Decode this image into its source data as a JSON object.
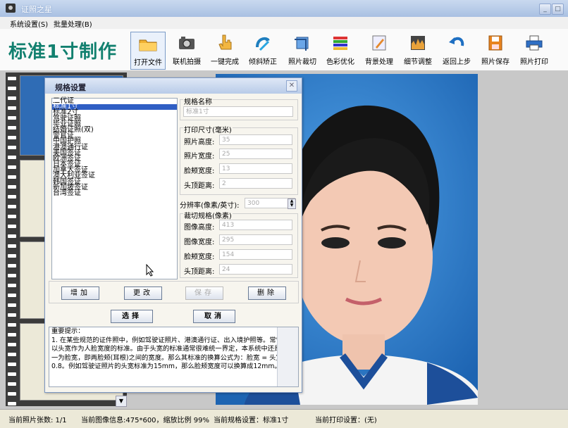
{
  "window": {
    "title": "证照之星"
  },
  "menu": {
    "items": [
      "系统设置(S)",
      "批量处理(B)"
    ]
  },
  "toolbar": {
    "app_heading": "标准1寸制作",
    "buttons": [
      "打开文件",
      "联机拍摄",
      "一键完成",
      "倾斜矫正",
      "照片裁切",
      "色彩优化",
      "背景处理",
      "细节调整",
      "返回上步",
      "照片保存",
      "照片打印"
    ]
  },
  "dialog": {
    "title": "规格设置",
    "spec_list": [
      "二代证",
      "标准1寸",
      "标准2寸",
      "驾驶证照",
      "毕业证照",
      "结婚证照(双)",
      "警官证",
      "中国护照",
      "港澳通行证",
      "美国签证",
      "欧洲签证",
      "日本签证",
      "加拿大签证",
      "澳大利亚签证",
      "韩国签证",
      "新加坡签证",
      "台湾签证"
    ],
    "selected_index": 1,
    "spec_name_group": "规格名称",
    "spec_name_value": "标准1寸",
    "print_size_group": "打印尺寸(毫米)",
    "print_size_fields": [
      {
        "label": "照片高度:",
        "value": "35"
      },
      {
        "label": "照片宽度:",
        "value": "25"
      },
      {
        "label": "脸颊宽度:",
        "value": "13"
      },
      {
        "label": "头顶距离:",
        "value": "2"
      }
    ],
    "resolution_label": "分辨率(像素/英寸):",
    "resolution_value": "300",
    "crop_group": "裁切规格(像素)",
    "crop_fields": [
      {
        "label": "图像高度:",
        "value": "413"
      },
      {
        "label": "图像宽度:",
        "value": "295"
      },
      {
        "label": "脸颊宽度:",
        "value": "154"
      },
      {
        "label": "头顶距离:",
        "value": "24"
      }
    ],
    "buttons": {
      "add": "增加",
      "modify": "更改",
      "save": "保存",
      "delete": "删除",
      "select": "选择",
      "cancel": "取消"
    },
    "notes": "重要提示：\n1. 在某些规范的证件照中，例如驾驶证照片、港澳通行证、出入境护照等。常常以头宽作为人脸宽度的标准。由于头宽的标准通常很难统一界定，本系统中还是统一为脸宽，即两脸颊(耳根)之间的宽度。那么其标准的换算公式为：脸宽 = 头宽 * 0.8。例如驾驶证照片的头宽标准为15mm，那么脸颊宽度可以换算成12mm。"
  },
  "status": {
    "count": "当前照片张数: 1/1",
    "image_info": "当前图像信息:475*600，缩放比例 99%",
    "spec": "当前规格设置：标准1寸",
    "print": "当前打印设置：(无)"
  }
}
